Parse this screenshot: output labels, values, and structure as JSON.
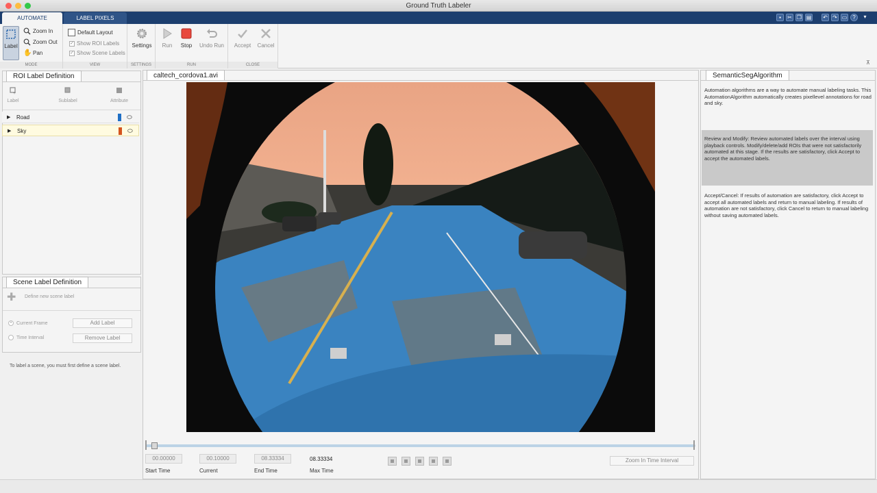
{
  "window": {
    "title": "Ground Truth Labeler",
    "traffic_colors": [
      "#fc605b",
      "#fdbc40",
      "#34c84a"
    ]
  },
  "ribbon_tabs": [
    {
      "label": "AUTOMATE"
    },
    {
      "label": "LABEL PIXELS"
    }
  ],
  "quick_access": [
    "save-icon",
    "cut-icon",
    "copy-icon",
    "paste-icon",
    "undo-icon",
    "redo-icon",
    "help-icon",
    "minimize-icon"
  ],
  "ribbon": {
    "mode": {
      "label": "MODE",
      "label_btn": "Label",
      "zoom_in": "Zoom In",
      "zoom_out": "Zoom Out",
      "pan": "Pan"
    },
    "view": {
      "label": "VIEW",
      "default_layout": "Default Layout",
      "show_roi": "Show ROI Labels",
      "show_scene": "Show Scene Labels"
    },
    "settings": {
      "label": "SETTINGS",
      "settings_btn": "Settings"
    },
    "run": {
      "label": "RUN",
      "run_btn": "Run",
      "stop_btn": "Stop",
      "undo_run_btn": "Undo Run"
    },
    "close": {
      "label": "CLOSE",
      "accept_btn": "Accept",
      "cancel_btn": "Cancel"
    }
  },
  "roi_panel": {
    "title": "ROI Label Definition",
    "buttons": {
      "label": "Label",
      "sublabel": "Sublabel",
      "attribute": "Attribute"
    },
    "labels": [
      {
        "name": "Road",
        "color": "#1f6fc5"
      },
      {
        "name": "Sky",
        "color": "#d4541e"
      }
    ]
  },
  "scene_panel": {
    "title": "Scene Label Definition",
    "define_placeholder": "Define new scene label",
    "current_frame": "Current Frame",
    "time_interval": "Time Interval",
    "add_label": "Add Label",
    "remove_label": "Remove Label",
    "hint": "To label a scene, you must first define a scene label."
  },
  "video": {
    "tab": "caltech_cordova1.avi",
    "start_time": "00.00000",
    "current": "00.10000",
    "end_time": "08.33334",
    "max_time": "08.33334",
    "start_caption": "Start Time",
    "current_caption": "Current",
    "end_caption": "End Time",
    "max_caption": "Max Time",
    "zoom_interval": "Zoom In Time Interval"
  },
  "algorithm_panel": {
    "title": "SemanticSegAlgorithm",
    "intro": "Automation algorithms are a way to automate manual labeling tasks. This AutomationAlgorithm automatically creates pixellevel annotations for road and sky.",
    "review": "Review and Modify: Review automated labels over the interval using playback controls. Modify/delete/add ROIs that were not satisfactorily automated at this stage. If the results are satisfactory, click Accept to accept the automated labels.",
    "accept_cancel": "Accept/Cancel: If results of automation are satisfactory, click Accept to accept all automated labels and return to manual labeling. If results of automation are not satisfactory, click Cancel to return to manual labeling without saving automated labels."
  }
}
